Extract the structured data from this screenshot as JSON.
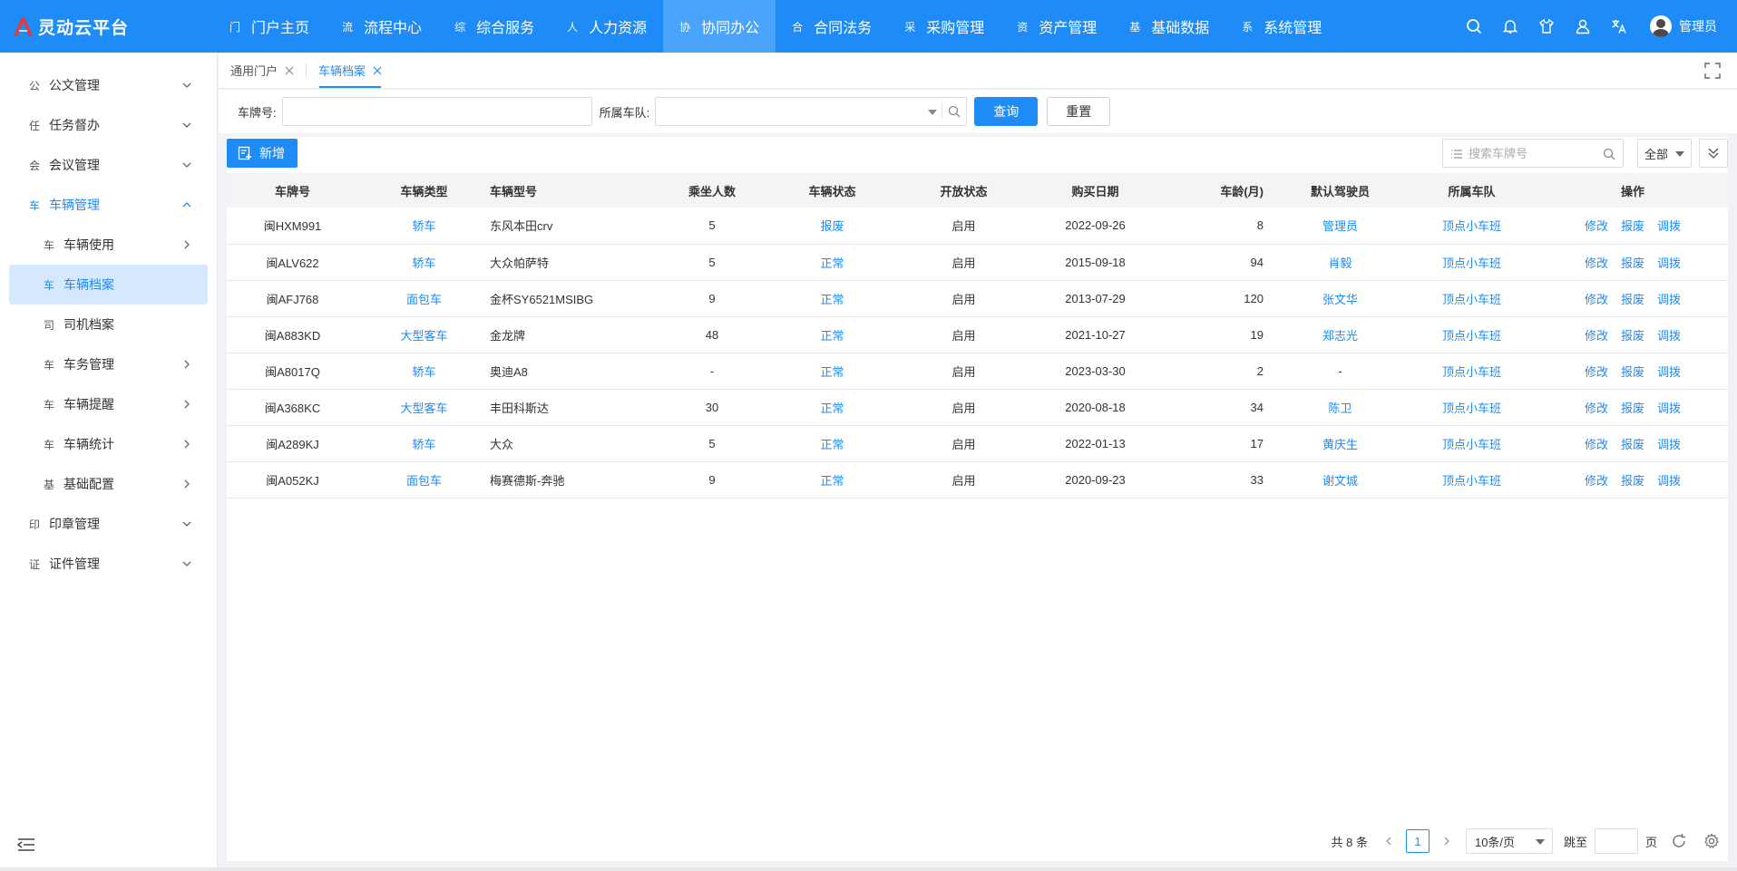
{
  "app": {
    "title": "灵动云平台",
    "accent": "#1e8bf7"
  },
  "topnav": [
    {
      "glyph": "门",
      "label": "门户主页",
      "active": false
    },
    {
      "glyph": "流",
      "label": "流程中心",
      "active": false
    },
    {
      "glyph": "综",
      "label": "综合服务",
      "active": false
    },
    {
      "glyph": "人",
      "label": "人力资源",
      "active": false
    },
    {
      "glyph": "协",
      "label": "协同办公",
      "active": true
    },
    {
      "glyph": "合",
      "label": "合同法务",
      "active": false
    },
    {
      "glyph": "采",
      "label": "采购管理",
      "active": false
    },
    {
      "glyph": "资",
      "label": "资产管理",
      "active": false
    },
    {
      "glyph": "基",
      "label": "基础数据",
      "active": false
    },
    {
      "glyph": "系",
      "label": "系统管理",
      "active": false
    }
  ],
  "user": {
    "name": "管理员"
  },
  "sidebar": {
    "items": [
      {
        "glyph": "公",
        "label": "公文管理"
      },
      {
        "glyph": "任",
        "label": "任务督办"
      },
      {
        "glyph": "会",
        "label": "会议管理"
      },
      {
        "glyph": "车",
        "label": "车辆管理"
      },
      {
        "glyph": "车",
        "label": "车辆使用"
      },
      {
        "glyph": "车",
        "label": "车辆档案"
      },
      {
        "glyph": "司",
        "label": "司机档案"
      },
      {
        "glyph": "车",
        "label": "车务管理"
      },
      {
        "glyph": "车",
        "label": "车辆提醒"
      },
      {
        "glyph": "车",
        "label": "车辆统计"
      },
      {
        "glyph": "基",
        "label": "基础配置"
      },
      {
        "glyph": "印",
        "label": "印章管理"
      },
      {
        "glyph": "证",
        "label": "证件管理"
      }
    ]
  },
  "tabs": [
    {
      "label": "通用门户"
    },
    {
      "label": "车辆档案"
    }
  ],
  "filters": {
    "plate_label": "车牌号:",
    "plate_value": "",
    "fleet_label": "所属车队:",
    "query_label": "查询",
    "reset_label": "重置"
  },
  "toolbar": {
    "add_label": "新增",
    "search_placeholder": "搜索车牌号",
    "scope_label": "全部"
  },
  "table": {
    "headers": [
      "车牌号",
      "车辆类型",
      "车辆型号",
      "乘坐人数",
      "车辆状态",
      "开放状态",
      "购买日期",
      "车龄(月)",
      "默认驾驶员",
      "所属车队",
      "操作"
    ],
    "actions": [
      "修改",
      "报废",
      "调拨"
    ],
    "rows": [
      [
        "闽HXM991",
        "轿车",
        "东风本田crv",
        "5",
        "报废",
        "启用",
        "2022-09-26",
        "8",
        "管理员",
        "顶点小车班"
      ],
      [
        "闽ALV622",
        "轿车",
        "大众帕萨特",
        "5",
        "正常",
        "启用",
        "2015-09-18",
        "94",
        "肖毅",
        "顶点小车班"
      ],
      [
        "闽AFJ768",
        "面包车",
        "金杯SY6521MSIBG",
        "9",
        "正常",
        "启用",
        "2013-07-29",
        "120",
        "张文华",
        "顶点小车班"
      ],
      [
        "闽A883KD",
        "大型客车",
        "金龙牌",
        "48",
        "正常",
        "启用",
        "2021-10-27",
        "19",
        "郑志光",
        "顶点小车班"
      ],
      [
        "闽A8017Q",
        "轿车",
        "奥迪A8",
        "-",
        "正常",
        "启用",
        "2023-03-30",
        "2",
        "-",
        "顶点小车班"
      ],
      [
        "闽A368KC",
        "大型客车",
        "丰田科斯达",
        "30",
        "正常",
        "启用",
        "2020-08-18",
        "34",
        "陈卫",
        "顶点小车班"
      ],
      [
        "闽A289KJ",
        "轿车",
        "大众",
        "5",
        "正常",
        "启用",
        "2022-01-13",
        "17",
        "黄庆生",
        "顶点小车班"
      ],
      [
        "闽A052KJ",
        "面包车",
        "梅赛德斯-奔驰",
        "9",
        "正常",
        "启用",
        "2020-09-23",
        "33",
        "谢文城",
        "顶点小车班"
      ]
    ]
  },
  "pagination": {
    "total_label": "共 8 条",
    "current_page": "1",
    "page_size": "10条/页",
    "jump_label": "跳至",
    "page_unit": "页"
  }
}
